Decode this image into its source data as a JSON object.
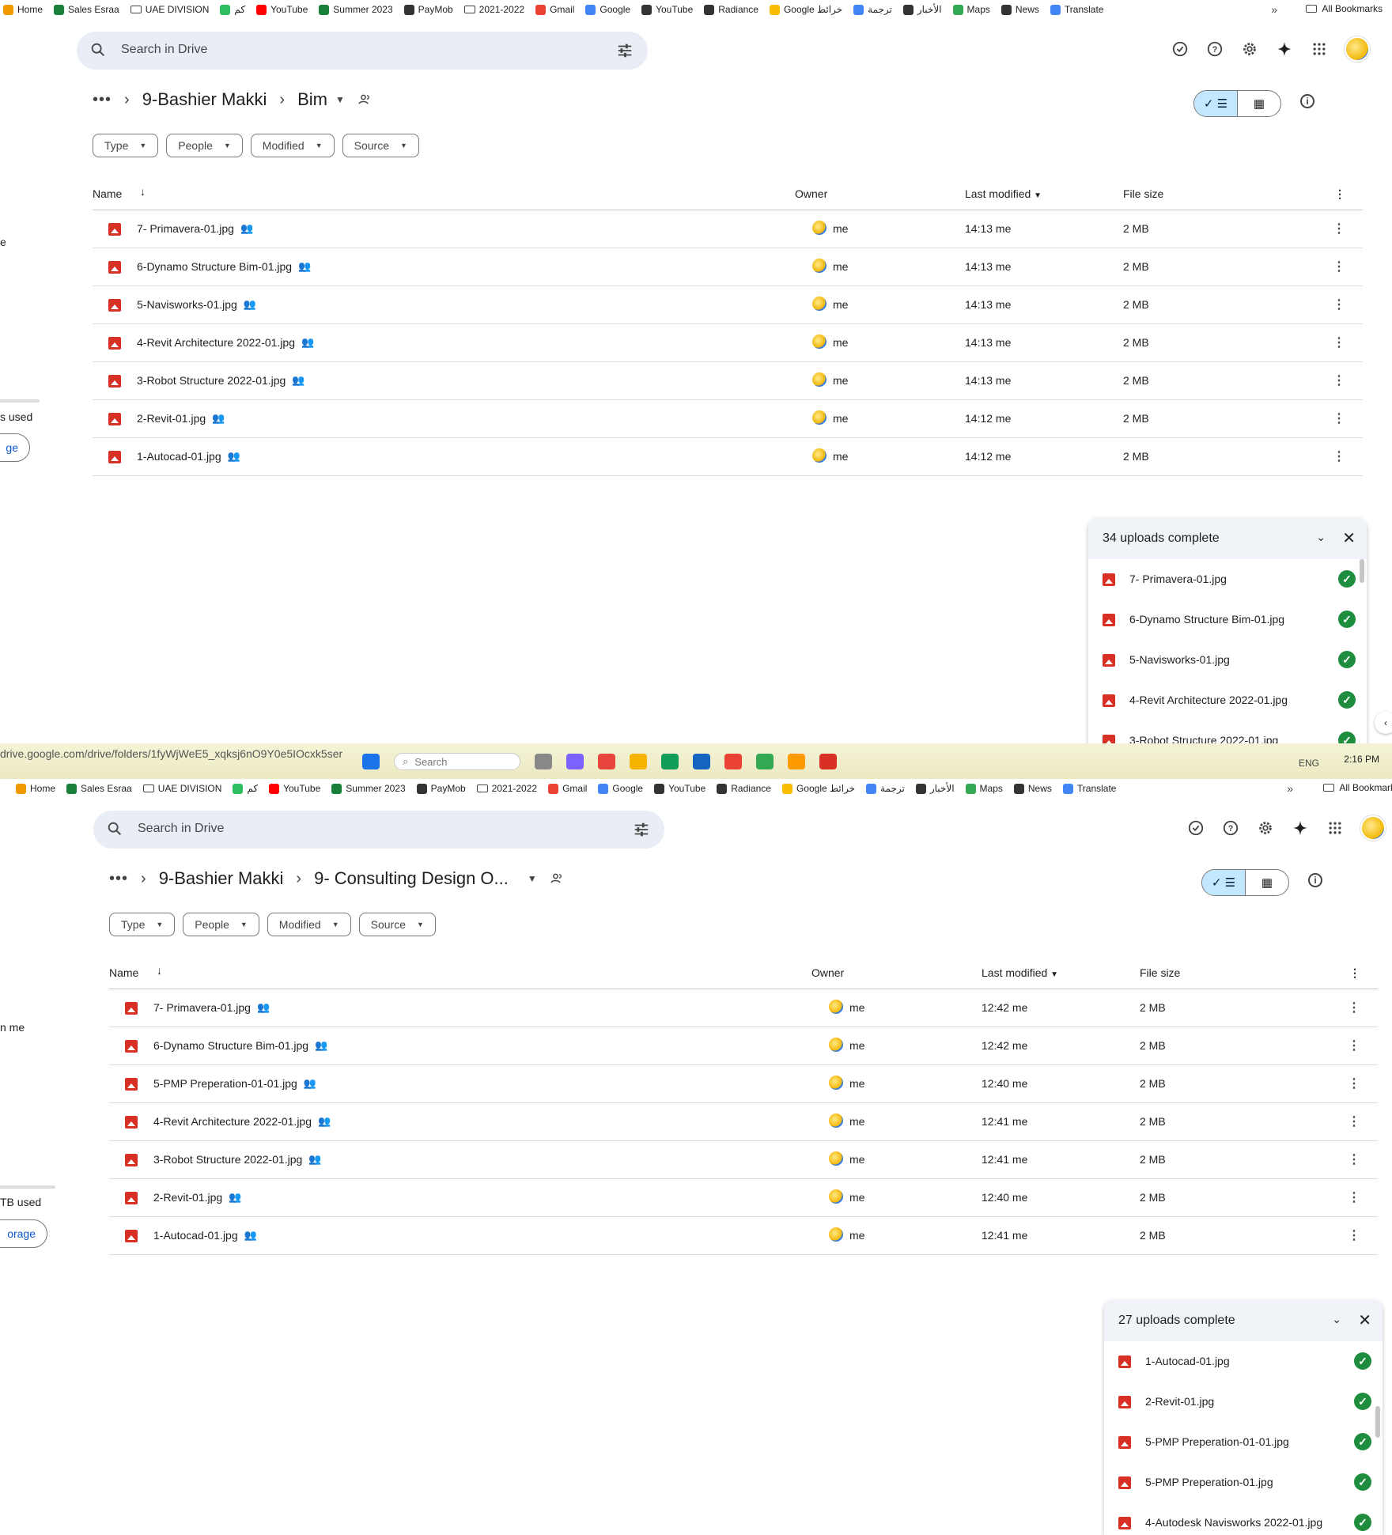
{
  "bookmarks": {
    "items": [
      {
        "label": "Home",
        "color": "#f29900"
      },
      {
        "label": "Sales Esraa",
        "color": "#188038"
      },
      {
        "label": "UAE DIVISION",
        "color": "#ffffff",
        "folder": true
      },
      {
        "label": "كم",
        "color": "#2dbe60"
      },
      {
        "label": "YouTube",
        "color": "#ff0000"
      },
      {
        "label": "Summer 2023",
        "color": "#188038"
      },
      {
        "label": "PayMob",
        "color": "#333333"
      },
      {
        "label": "2021-2022",
        "color": "#ffffff",
        "folder": true
      },
      {
        "label": "Gmail",
        "color": "#ea4335"
      },
      {
        "label": "Google",
        "color": "#4285f4"
      },
      {
        "label": "YouTube",
        "color": "#333333"
      },
      {
        "label": "Radiance",
        "color": "#333333"
      },
      {
        "label": "Google خرائط",
        "color": "#fbbc04"
      },
      {
        "label": "ترجمة",
        "color": "#4285f4"
      },
      {
        "label": "الأخبار",
        "color": "#333333"
      },
      {
        "label": "Maps",
        "color": "#34a853"
      },
      {
        "label": "News",
        "color": "#333333"
      },
      {
        "label": "Translate",
        "color": "#4285f4"
      }
    ],
    "more": "»",
    "all_label": "All Bookmarks",
    "all_label_bottom": "All Bookmark"
  },
  "search": {
    "placeholder": "Search in Drive"
  },
  "top": {
    "left_used": "s used",
    "left_storage": "ge",
    "left_e": "e",
    "breadcrumb": {
      "root": "9-Bashier Makki",
      "current": "Bim"
    },
    "filters": [
      "Type",
      "People",
      "Modified",
      "Source"
    ],
    "columns": {
      "name": "Name",
      "owner": "Owner",
      "modified": "Last modified",
      "size": "File size"
    },
    "rows": [
      {
        "name": "7- Primavera-01.jpg",
        "owner": "me",
        "modified": "14:13 me",
        "size": "2 MB"
      },
      {
        "name": "6-Dynamo Structure Bim-01.jpg",
        "owner": "me",
        "modified": "14:13 me",
        "size": "2 MB"
      },
      {
        "name": "5-Navisworks-01.jpg",
        "owner": "me",
        "modified": "14:13 me",
        "size": "2 MB"
      },
      {
        "name": "4-Revit  Architecture 2022-01.jpg",
        "owner": "me",
        "modified": "14:13 me",
        "size": "2 MB"
      },
      {
        "name": "3-Robot Structure 2022-01.jpg",
        "owner": "me",
        "modified": "14:13 me",
        "size": "2 MB"
      },
      {
        "name": "2-Revit-01.jpg",
        "owner": "me",
        "modified": "14:12 me",
        "size": "2 MB"
      },
      {
        "name": "1-Autocad-01.jpg",
        "owner": "me",
        "modified": "14:12 me",
        "size": "2 MB"
      }
    ],
    "uploads": {
      "title": "34 uploads complete",
      "items": [
        "7- Primavera-01.jpg",
        "6-Dynamo Structure Bim-01.jpg",
        "5-Navisworks-01.jpg",
        "4-Revit Architecture 2022-01.jpg",
        "3-Robot Structure 2022-01.jpg"
      ]
    }
  },
  "taskbar": {
    "url": "drive.google.com/drive/folders/1fyWjWeE5_xqksj6nO9Y0e5IOcxk5ser",
    "search": "Search",
    "time": "2:16 PM",
    "lang": "ENG"
  },
  "bottom": {
    "left_me": "n me",
    "left_used": "TB used",
    "left_storage": "orage",
    "breadcrumb": {
      "root": "9-Bashier Makki",
      "current": "9- Consulting Design O..."
    },
    "filters": [
      "Type",
      "People",
      "Modified",
      "Source"
    ],
    "columns": {
      "name": "Name",
      "owner": "Owner",
      "modified": "Last modified",
      "size": "File size"
    },
    "rows": [
      {
        "name": "7- Primavera-01.jpg",
        "owner": "me",
        "modified": "12:42 me",
        "size": "2 MB"
      },
      {
        "name": "6-Dynamo Structure Bim-01.jpg",
        "owner": "me",
        "modified": "12:42 me",
        "size": "2 MB"
      },
      {
        "name": "5-PMP Preperation-01-01.jpg",
        "owner": "me",
        "modified": "12:40 me",
        "size": "2 MB"
      },
      {
        "name": "4-Revit  Architecture 2022-01.jpg",
        "owner": "me",
        "modified": "12:41 me",
        "size": "2 MB"
      },
      {
        "name": "3-Robot Structure 2022-01.jpg",
        "owner": "me",
        "modified": "12:41 me",
        "size": "2 MB"
      },
      {
        "name": "2-Revit-01.jpg",
        "owner": "me",
        "modified": "12:40 me",
        "size": "2 MB"
      },
      {
        "name": "1-Autocad-01.jpg",
        "owner": "me",
        "modified": "12:41 me",
        "size": "2 MB"
      }
    ],
    "uploads": {
      "title": "27 uploads complete",
      "items": [
        "1-Autocad-01.jpg",
        "2-Revit-01.jpg",
        "5-PMP Preperation-01-01.jpg",
        "5-PMP Preperation-01.jpg",
        "4-Autodesk Navisworks 2022-01.jpg"
      ]
    }
  }
}
